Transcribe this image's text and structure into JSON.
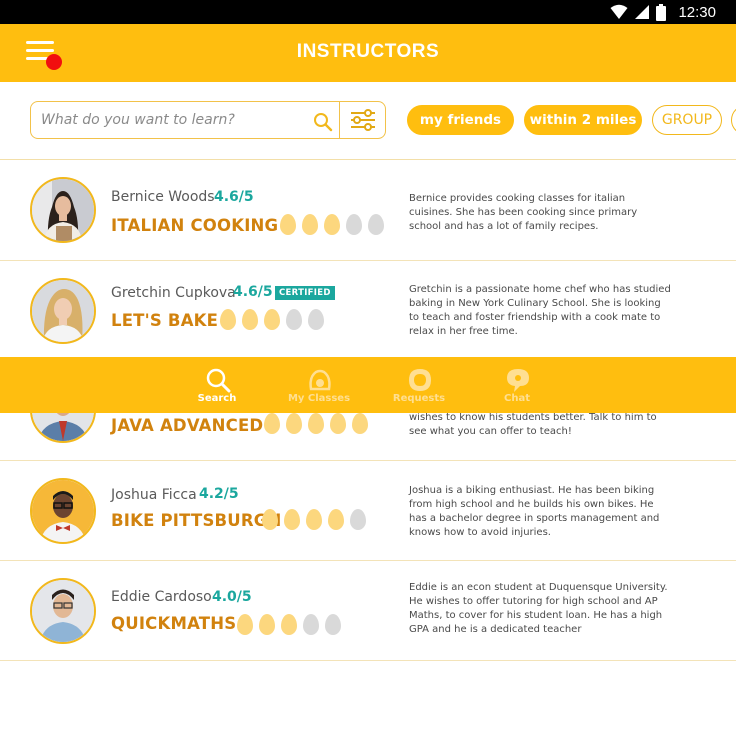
{
  "status_bar": {
    "time": "12:30"
  },
  "header": {
    "title": "INSTRUCTORS"
  },
  "search": {
    "placeholder": "What do you want to learn?"
  },
  "filters": [
    {
      "label": "my friends",
      "style": "filled"
    },
    {
      "label": "within 2 miles",
      "style": "filled"
    },
    {
      "label": "GROUP",
      "style": "outline"
    }
  ],
  "instructors": [
    {
      "name": "Bernice Woods",
      "rating": "4.6/5",
      "course": "ITALIAN COOKING",
      "level": 3,
      "level_max": 5,
      "description": "Bernice provides cooking classes for italian cuisines. She has been cooking since primary school and has a lot of family recipes."
    },
    {
      "name": "Gretchin Cupkova",
      "rating": "4.6/5",
      "badge": "CERTIFIED",
      "course": "LET'S BAKE",
      "level": 3,
      "level_max": 5,
      "description": "Gretchin is a passionate home chef who has studied baking in New York Culinary School. She is looking to teach and foster friendship with a cook mate to relax in her free time."
    },
    {
      "course": "JAVA ADVANCED",
      "level": 5,
      "level_max": 5,
      "description": "wishes to know his students better. Talk to him to see what you can offer to teach!"
    },
    {
      "name": "Joshua Ficca",
      "rating": "4.2/5",
      "course": "BIKE PITTSBURGH",
      "level": 4,
      "level_max": 5,
      "description": "Joshua is a biking enthusiast. He has been biking from high school and he builds his own bikes. He has a bachelor degree in sports management and knows how to avoid injuries."
    },
    {
      "name": "Eddie Cardoso",
      "rating": "4.0/5",
      "course": "QUICKMATHS",
      "level": 3,
      "level_max": 5,
      "description": "Eddie is an econ student at Duquensque University. He wishes to offer tutoring for high school and AP Maths, to cover for his student loan. He has a high GPA and he is a dedicated teacher"
    }
  ],
  "tabs": [
    {
      "label": "Search",
      "icon": "search-icon",
      "active": true
    },
    {
      "label": "My Classes",
      "icon": "classes-icon",
      "active": false
    },
    {
      "label": "Requests",
      "icon": "requests-icon",
      "active": false
    },
    {
      "label": "Chat",
      "icon": "chat-icon",
      "active": false
    }
  ],
  "colors": {
    "primary": "#FFBE0F",
    "course_text": "#D1820E",
    "rating_text": "#1BA79E",
    "notification_dot": "#F10F0F",
    "level_on": "#FCD77E",
    "level_off": "#D9D9D9"
  }
}
